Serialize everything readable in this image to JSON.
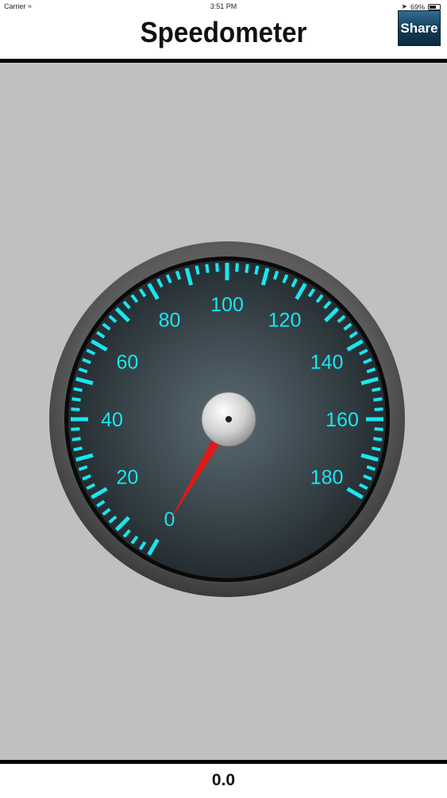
{
  "status_bar": {
    "carrier": "Carrier",
    "time": "3:51 PM",
    "battery_text": "69%",
    "battery_level": 0.69
  },
  "navbar": {
    "title": "Speedometer",
    "share_label": "Share"
  },
  "gauge": {
    "labels": [
      "0",
      "20",
      "40",
      "60",
      "80",
      "100",
      "120",
      "140",
      "160",
      "180"
    ],
    "min": 0,
    "max": 180,
    "current_value": 0,
    "accent_color": "#19e6f0",
    "needle_color": "#e01919"
  },
  "bottom": {
    "speed_text": "0.0"
  }
}
